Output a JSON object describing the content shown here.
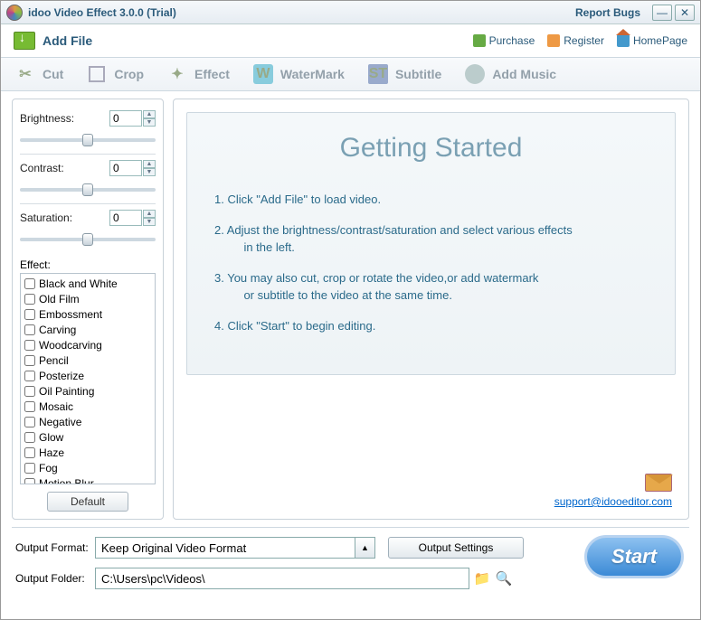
{
  "titlebar": {
    "title": "idoo Video Effect 3.0.0 (Trial)",
    "report": "Report Bugs"
  },
  "menubar": {
    "addfile": "Add File",
    "purchase": "Purchase",
    "register": "Register",
    "homepage": "HomePage"
  },
  "toolbar": {
    "cut": "Cut",
    "crop": "Crop",
    "effect": "Effect",
    "watermark": "WaterMark",
    "subtitle": "Subtitle",
    "addmusic": "Add Music"
  },
  "sliders": {
    "brightness": {
      "label": "Brightness:",
      "value": "0"
    },
    "contrast": {
      "label": "Contrast:",
      "value": "0"
    },
    "saturation": {
      "label": "Saturation:",
      "value": "0"
    }
  },
  "effect_label": "Effect:",
  "effects": [
    "Black and White",
    "Old Film",
    "Embossment",
    "Carving",
    "Woodcarving",
    "Pencil",
    "Posterize",
    "Oil Painting",
    "Mosaic",
    "Negative",
    "Glow",
    "Haze",
    "Fog",
    "Motion Blur"
  ],
  "default_btn": "Default",
  "started": {
    "title": "Getting Started",
    "s1": "1. Click \"Add File\" to load video.",
    "s2a": "2. Adjust the brightness/contrast/saturation and select various effects",
    "s2b": "in the left.",
    "s3a": "3. You may also cut, crop or rotate the video,or add watermark",
    "s3b": "or subtitle to the video at the same time.",
    "s4": "4. Click \"Start\" to begin editing."
  },
  "support_link": "support@idooeditor.com",
  "bottom": {
    "format_label": "Output Format:",
    "format_value": "Keep Original Video Format",
    "output_settings": "Output Settings",
    "folder_label": "Output Folder:",
    "folder_value": "C:\\Users\\pc\\Videos\\",
    "start": "Start"
  }
}
